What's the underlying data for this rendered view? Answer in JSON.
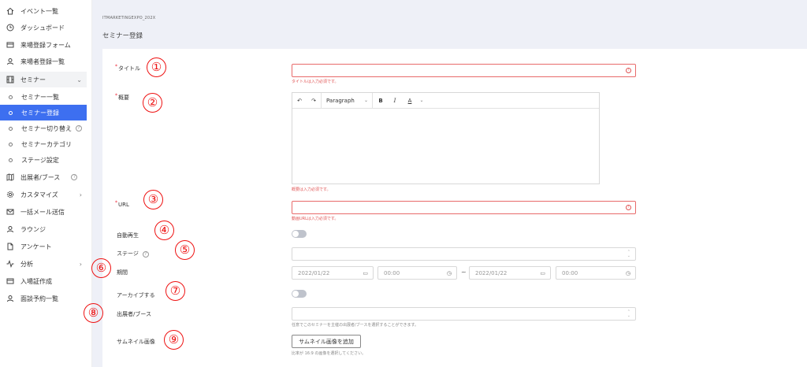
{
  "sidebar": {
    "items": [
      {
        "label": "イベント一覧",
        "icon": "home-icon"
      },
      {
        "label": "ダッシュボード",
        "icon": "clock-icon"
      },
      {
        "label": "来場登録フォーム",
        "icon": "form-icon"
      },
      {
        "label": "来場者登録一覧",
        "icon": "user-icon"
      },
      {
        "label": "セミナー",
        "icon": "film-icon",
        "chevron": "⌄"
      },
      {
        "label": "セミナー一覧"
      },
      {
        "label": "セミナー登録"
      },
      {
        "label": "セミナー切り替え"
      },
      {
        "label": "セミナーカテゴリ"
      },
      {
        "label": "ステージ設定"
      },
      {
        "label": "出展者/ブース",
        "icon": "map-icon"
      },
      {
        "label": "カスタマイズ",
        "icon": "gear-icon",
        "chevron": "›"
      },
      {
        "label": "一括メール送信",
        "icon": "mail-icon"
      },
      {
        "label": "ラウンジ",
        "icon": "user-icon"
      },
      {
        "label": "アンケート",
        "icon": "document-icon"
      },
      {
        "label": "分析",
        "icon": "activity-icon",
        "chevron": "›"
      },
      {
        "label": "入場証作成",
        "icon": "card-icon"
      },
      {
        "label": "面談予約一覧",
        "icon": "user-icon"
      }
    ],
    "help_mark": "?"
  },
  "header": {
    "breadcrumb": "ITMARKETINGEXPO_202X",
    "title": "セミナー登録"
  },
  "form": {
    "required_mark": "*",
    "title_label": "タイトル",
    "title_error": "タイトルは入力必須です。",
    "summary_label": "概要",
    "summary_error": "概要は入力必須です。",
    "editor": {
      "undo": "↶",
      "redo": "↷",
      "format": "Paragraph",
      "bold": "B",
      "italic": "I",
      "color": "A"
    },
    "url_label": "URL",
    "url_error": "動画URLは入力必須です。",
    "autoplay_label": "自動再生",
    "stage_label": "ステージ",
    "period_label": "期間",
    "start_date": "2022/01/22",
    "start_time": "00:00",
    "tilde": "~",
    "end_date": "2022/01/22",
    "end_time": "00:00",
    "archive_label": "アーカイブする",
    "exhibitor_label": "出展者/ブース",
    "exhibitor_hint": "任意でこのセミナーを主催の出展者/ブースを選択することができます。",
    "thumbnail_label": "サムネイル画像",
    "thumbnail_button": "サムネイル画像を追加",
    "thumbnail_hint": "比率が 16:9 の画像を選択してください。",
    "error_mark": "!",
    "select_arrows": "⌃⌄"
  },
  "annotations": [
    "①",
    "②",
    "③",
    "④",
    "⑤",
    "⑥",
    "⑦",
    "⑧",
    "⑨"
  ],
  "colors": {
    "accent": "#3d6ff0",
    "error": "#e05555",
    "annotation": "#e11111",
    "background": "#eef0f7"
  }
}
